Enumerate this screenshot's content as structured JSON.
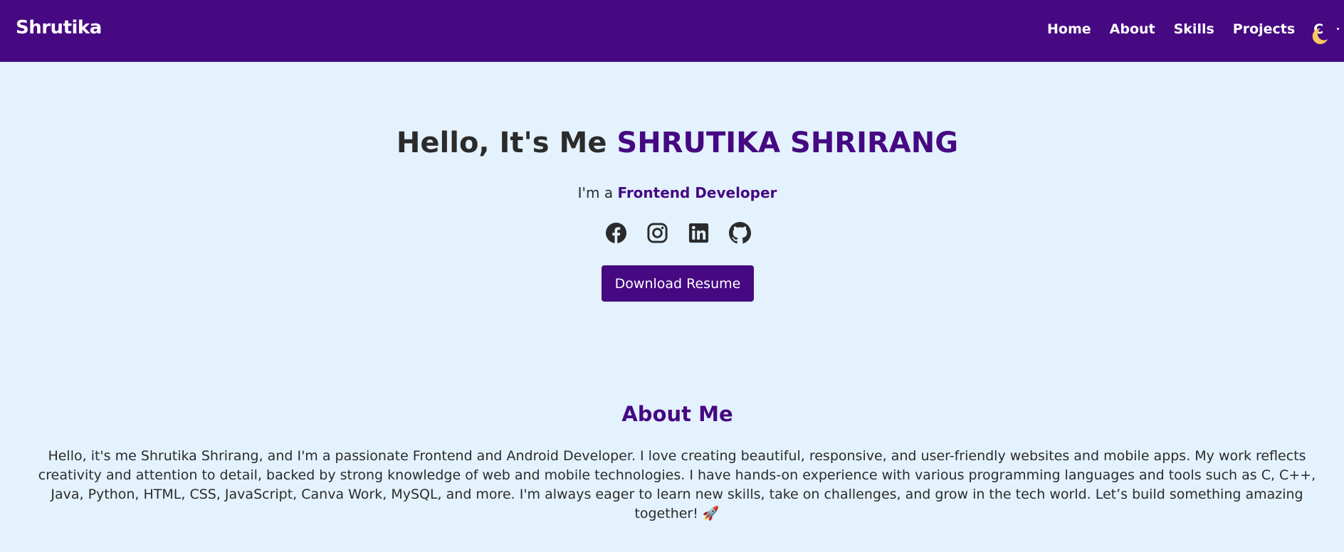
{
  "nav": {
    "brand": "Shrutika",
    "links": [
      "Home",
      "About",
      "Skills",
      "Projects",
      "C"
    ],
    "theme_toggle_icon": "moon-icon"
  },
  "hero": {
    "greeting": "Hello, It's Me ",
    "name": "SHRUTIKA SHRIRANG",
    "subtitle_prefix": "I'm a ",
    "role": "Frontend Developer",
    "socials": [
      "facebook-icon",
      "instagram-icon",
      "linkedin-icon",
      "github-icon"
    ],
    "button_label": "Download Resume"
  },
  "about": {
    "title": "About Me",
    "text": "Hello, it's me Shrutika Shrirang, and I'm a passionate Frontend and Android Developer. I love creating beautiful, responsive, and user-friendly websites and mobile apps. My work reflects creativity and attention to detail, backed by strong knowledge of web and mobile technologies. I have hands-on experience with various programming languages and tools such as C, C++, Java, Python, HTML, CSS, JavaScript, Canva Work, MySQL, and more. I'm always eager to learn new skills, take on challenges, and grow in the tech world. Let’s build something amazing together! 🚀"
  },
  "colors": {
    "accent": "#460982",
    "background": "#e3f2fd",
    "text": "#2b2b2b"
  }
}
